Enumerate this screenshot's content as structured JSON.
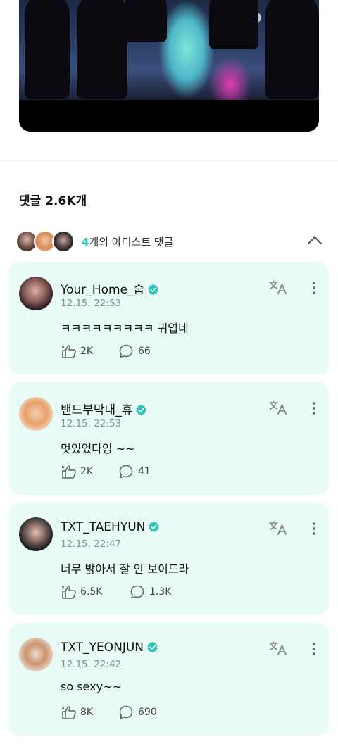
{
  "comments": {
    "title": "댓글 2.6K개"
  },
  "artist_comments": {
    "count": "4",
    "suffix": "개의 아티스트 댓글"
  },
  "items": [
    {
      "username": "Your_Home_숩",
      "timestamp": "12.15. 22:53",
      "text": "ㅋㅋㅋㅋㅋㅋㅋㅋㅋ 귀엽네",
      "likes": "2K",
      "replies": "66"
    },
    {
      "username": "밴드부막내_휴",
      "timestamp": "12.15. 22:53",
      "text": "멋있었다잉 ~~",
      "likes": "2K",
      "replies": "41"
    },
    {
      "username": "TXT_TAEHYUN",
      "timestamp": "12.15. 22:47",
      "text": "너무 밝아서 잘 안 보이드라",
      "likes": "6.5K",
      "replies": "1.3K"
    },
    {
      "username": "TXT_YEONJUN",
      "timestamp": "12.15. 22:42",
      "text": "so sexy~~",
      "likes": "8K",
      "replies": "690"
    }
  ],
  "colors": {
    "accent": "#2cc4b7",
    "card_bg": "#e8fbf6"
  }
}
